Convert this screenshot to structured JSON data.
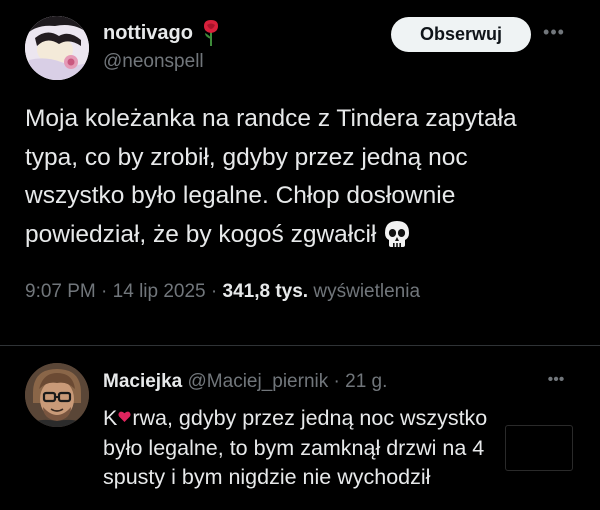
{
  "post": {
    "author_name": "nottivago",
    "author_handle": "@neonspell",
    "follow_label": "Obserwuj",
    "more_label": "•••",
    "text_lines": [
      "Moja koleżanka na randce z Tindera zapytała",
      "typa, co by zrobił, gdyby przez jedną noc",
      "wszystko było legalne. Chłop dosłownie",
      "powiedział, że by kogoś zgwałcił"
    ],
    "time": "9:07 PM",
    "date": "14 lip 2025",
    "views_count": "341,8 tys.",
    "views_label": "wyświetlenia",
    "separator": "·"
  },
  "reply": {
    "author_name": "Maciejka",
    "author_handle": "@Maciej_piernik",
    "separator": "·",
    "time_ago": "21 g.",
    "more_label": "•••",
    "text_first_start": "K",
    "text_first_end": "rwa, gdyby przez jedną noc wszystko",
    "text_lines": [
      "było legalne, to bym zamknął drzwi na 4",
      "spusty i bym nigdzie nie wychodził"
    ]
  },
  "icons": {
    "rose": "rose-icon",
    "skull": "skull-icon",
    "heart": "heart-icon",
    "more": "more-icon"
  },
  "colors": {
    "background": "#000000",
    "text_primary": "#e7e9ea",
    "text_secondary": "#71767b",
    "button_bg": "#eff3f4",
    "button_text": "#0f1419",
    "divider": "#2f3336",
    "accent_red": "#e0245e"
  }
}
